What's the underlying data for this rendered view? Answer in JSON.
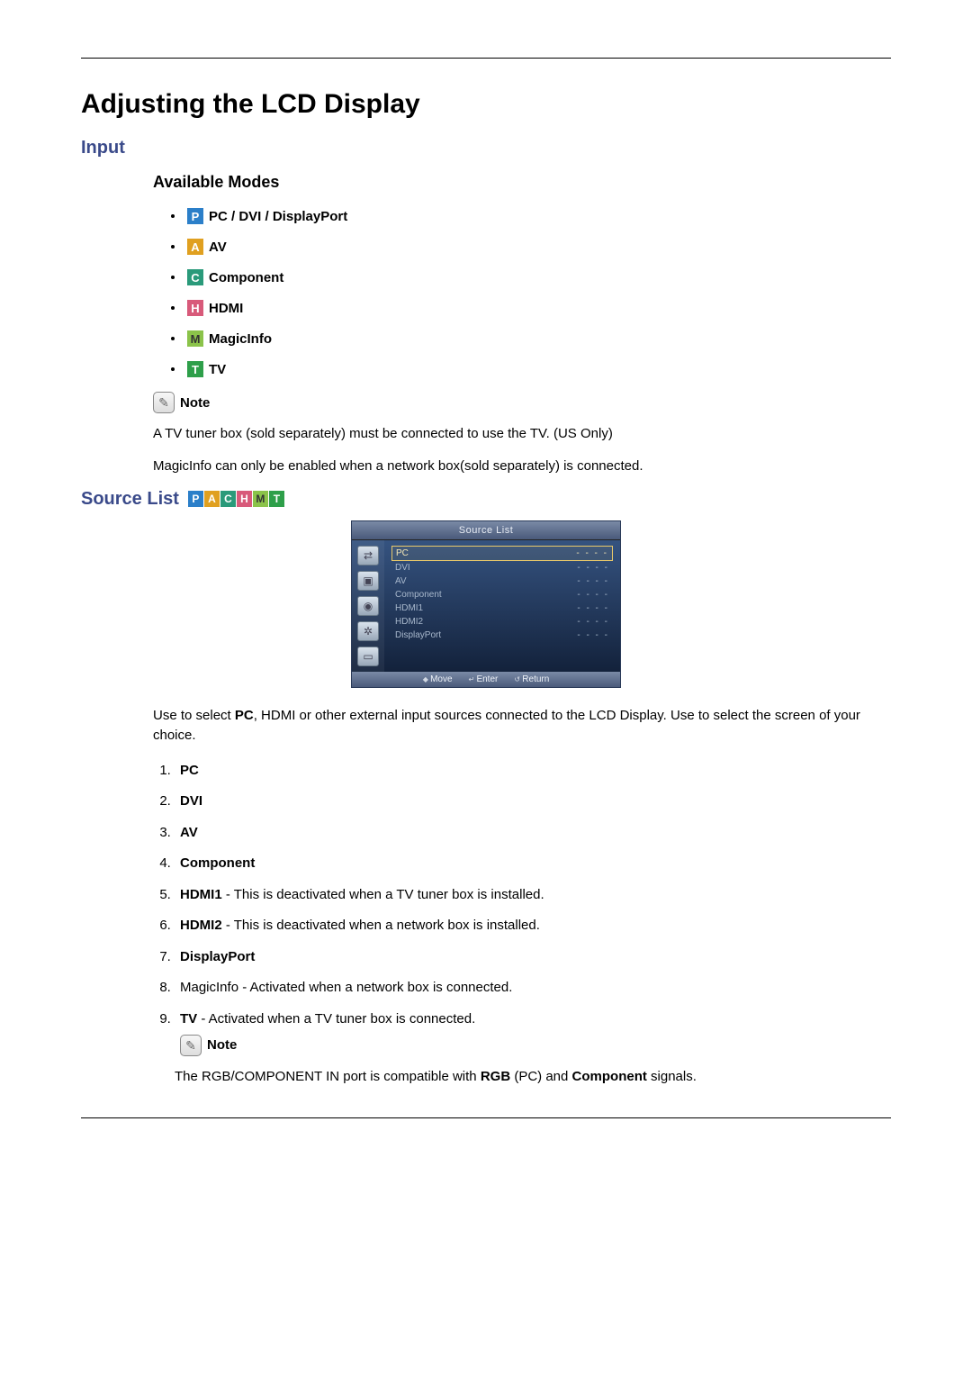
{
  "title": "Adjusting the LCD Display",
  "input_heading": "Input",
  "available_modes_heading": "Available Modes",
  "modes": [
    {
      "badge": "P",
      "label": "PC / DVI / DisplayPort"
    },
    {
      "badge": "A",
      "label": "AV"
    },
    {
      "badge": "C",
      "label": "Component"
    },
    {
      "badge": "H",
      "label": "HDMI"
    },
    {
      "badge": "M",
      "label": "MagicInfo"
    },
    {
      "badge": "T",
      "label": "TV"
    }
  ],
  "note_label": "Note",
  "note_text_1": "A TV tuner box (sold separately) must be connected to use the TV. (US Only)",
  "note_text_2": "MagicInfo can only be enabled when a network box(sold separately) is connected.",
  "source_list_heading": "Source List",
  "source_badges": [
    "P",
    "A",
    "C",
    "H",
    "M",
    "T"
  ],
  "osd": {
    "title": "Source List",
    "items": [
      {
        "label": "PC",
        "value": "- - - -",
        "selected": true
      },
      {
        "label": "DVI",
        "value": "- - - -"
      },
      {
        "label": "AV",
        "value": "- - - -"
      },
      {
        "label": "Component",
        "value": "- - - -"
      },
      {
        "label": "HDMI1",
        "value": "- - - -"
      },
      {
        "label": "HDMI2",
        "value": "- - - -"
      },
      {
        "label": "DisplayPort",
        "value": "- - - -"
      }
    ],
    "footer": {
      "move": "Move",
      "enter": "Enter",
      "return": "Return"
    }
  },
  "source_desc_1": "Use to select ",
  "source_desc_pc": "PC",
  "source_desc_2": ", HDMI or other external input sources connected to the LCD Display. Use to select the screen of your choice.",
  "list": {
    "i1": "PC",
    "i2": "DVI",
    "i3": "AV",
    "i4": "Component",
    "i5b": "HDMI1",
    "i5t": " - This is deactivated when a TV tuner box is installed.",
    "i6b": "HDMI2",
    "i6t": " - This is deactivated when a network box is installed.",
    "i7": "DisplayPort",
    "i8": "MagicInfo - Activated when a network box is connected.",
    "i9b": "TV",
    "i9t": " - Activated when a TV tuner box is connected."
  },
  "bottom_note_1a": "The RGB/COMPONENT IN port is compatible with ",
  "bottom_note_1b": "RGB",
  "bottom_note_1c": " (PC) and ",
  "bottom_note_1d": "Component",
  "bottom_note_1e": " signals."
}
